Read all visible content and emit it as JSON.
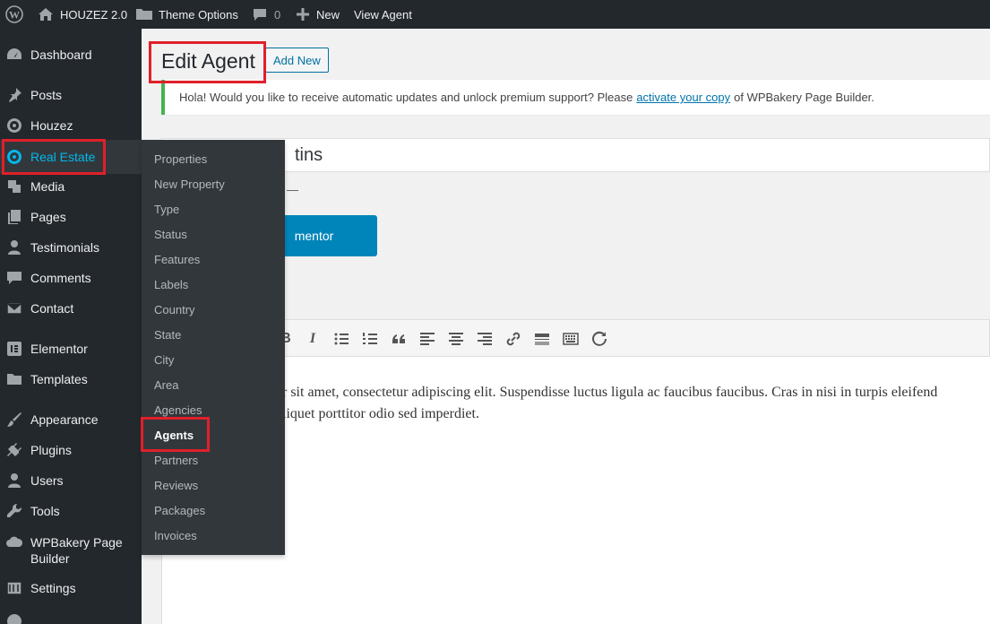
{
  "admin_bar": {
    "site_name": "HOUZEZ 2.0",
    "theme_options": "Theme Options",
    "comments_count": "0",
    "new_label": "New",
    "view_label": "View Agent"
  },
  "sidebar": {
    "items": [
      {
        "label": "Dashboard",
        "icon": "dashboard-icon"
      },
      {
        "label": "Posts",
        "icon": "pin-icon"
      },
      {
        "label": "Houzez",
        "icon": "location-icon"
      },
      {
        "label": "Real Estate",
        "icon": "location-icon"
      },
      {
        "label": "Media",
        "icon": "media-icon"
      },
      {
        "label": "Pages",
        "icon": "pages-icon"
      },
      {
        "label": "Testimonials",
        "icon": "user-icon"
      },
      {
        "label": "Comments",
        "icon": "comment-icon"
      },
      {
        "label": "Contact",
        "icon": "mail-icon"
      },
      {
        "label": "Elementor",
        "icon": "elementor-icon"
      },
      {
        "label": "Templates",
        "icon": "folder-icon"
      },
      {
        "label": "Appearance",
        "icon": "brush-icon"
      },
      {
        "label": "Plugins",
        "icon": "plugin-icon"
      },
      {
        "label": "Users",
        "icon": "users-icon"
      },
      {
        "label": "Tools",
        "icon": "wrench-icon"
      },
      {
        "label": "WPBakery Page",
        "label2": "Builder",
        "icon": "cloud-icon"
      },
      {
        "label": "Settings",
        "icon": "settings-icon"
      }
    ]
  },
  "flyout": {
    "items": [
      "Properties",
      "New Property",
      "Type",
      "Status",
      "Features",
      "Labels",
      "Country",
      "State",
      "City",
      "Area",
      "Agencies",
      "Agents",
      "Partners",
      "Reviews",
      "Packages",
      "Invoices"
    ]
  },
  "main": {
    "title": "Edit Agent",
    "add_new": "Add New",
    "notice_pre": "Hola! Would you like to receive automatic updates and unlock premium support? Please",
    "notice_link": "activate your copy",
    "notice_post": "of WPBakery Page Builder.",
    "post_title_visible": "tins",
    "elementor_button": "mentor",
    "body_line1": "r sit amet, consectetur adipiscing elit. Suspendisse luctus ligula ac faucibus faucibus. Cras in nisi in turpis eleifend",
    "body_line2": "liquet porttitor odio sed imperdiet."
  },
  "colors": {
    "adminbar_bg": "#23282d",
    "active_blue": "#00b9eb",
    "annotation_red": "#e0202a",
    "notice_green": "#46b450",
    "button_blue": "#0085ba"
  }
}
